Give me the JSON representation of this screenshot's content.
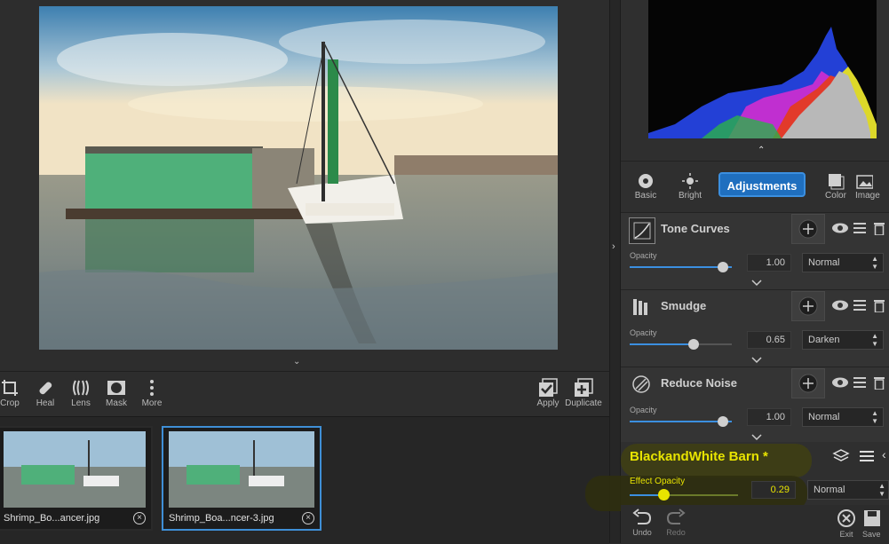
{
  "toolbar": {
    "tools": [
      {
        "label": "Crop",
        "icon": "crop-icon"
      },
      {
        "label": "Heal",
        "icon": "heal-icon"
      },
      {
        "label": "Lens",
        "icon": "lens-icon"
      },
      {
        "label": "Mask",
        "icon": "mask-icon"
      },
      {
        "label": "More",
        "icon": "more-icon"
      }
    ],
    "apply_label": "Apply",
    "duplicate_label": "Duplicate"
  },
  "filmstrip": {
    "items": [
      {
        "name": "Shrimp_Bo...ancer.jpg",
        "selected": false
      },
      {
        "name": "Shrimp_Boa...ncer-3.jpg",
        "selected": true
      }
    ]
  },
  "tabs": {
    "basic": "Basic",
    "bright": "Bright",
    "adjustments": "Adjustments",
    "color": "Color",
    "image": "Image"
  },
  "filters": [
    {
      "name": "Tone Curves",
      "opacity_label": "Opacity",
      "opacity": 1.0,
      "opacity_text": "1.00",
      "blend": "Normal",
      "icon": "tone-curve-icon"
    },
    {
      "name": "Smudge",
      "opacity_label": "Opacity",
      "opacity": 0.65,
      "opacity_text": "0.65",
      "blend": "Darken",
      "icon": "smudge-icon"
    },
    {
      "name": "Reduce Noise",
      "opacity_label": "Opacity",
      "opacity": 1.0,
      "opacity_text": "1.00",
      "blend": "Normal",
      "icon": "reduce-noise-icon"
    }
  ],
  "preset": {
    "name": "BlackandWhite Barn *",
    "effect_opacity_label": "Effect Opacity",
    "opacity": 0.29,
    "opacity_text": "0.29",
    "blend": "Normal"
  },
  "bottombar": {
    "undo": "Undo",
    "redo": "Redo",
    "exit": "Exit",
    "save": "Save"
  },
  "colors": {
    "accent": "#3b8fe0",
    "highlight": "#e8e400"
  }
}
